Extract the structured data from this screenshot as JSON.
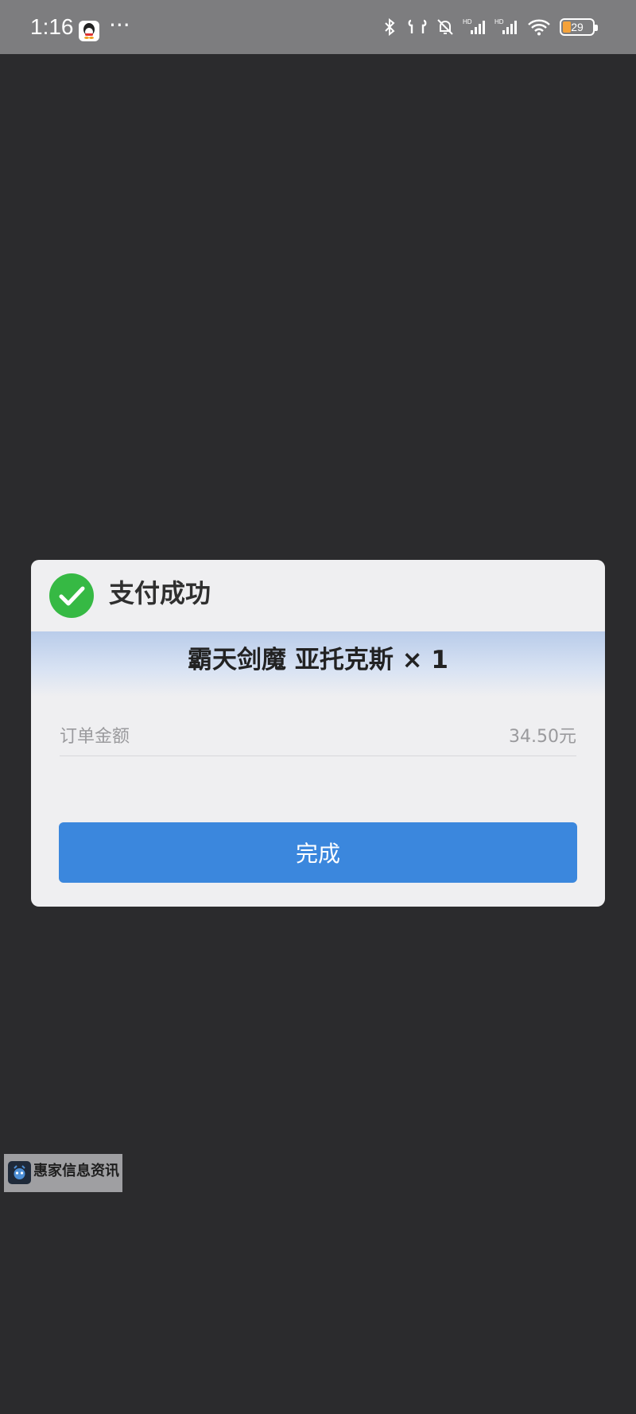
{
  "status_bar": {
    "time": "1:16",
    "dots": "···",
    "battery_level": "29",
    "icons": {
      "notification_app": "qq-icon",
      "bluetooth": "bluetooth-icon",
      "earbuds": "earbuds-icon",
      "silent": "bell-off-icon",
      "signal_1": "signal-hd-icon",
      "signal_2": "signal-hd-icon",
      "wifi": "wifi-icon",
      "battery": "battery-icon"
    }
  },
  "dialog": {
    "title": "支付成功",
    "product": "霸天剑魔 亚托克斯 × 1",
    "order_label": "订单金额",
    "order_amount": "34.50元",
    "button_label": "完成",
    "icons": {
      "success": "check-circle-icon"
    },
    "colors": {
      "success_green": "#36b944",
      "button_blue": "#3b87dd",
      "band_blue": "#b9ccea"
    }
  },
  "watermark": {
    "text": "惠家信息资讯"
  }
}
